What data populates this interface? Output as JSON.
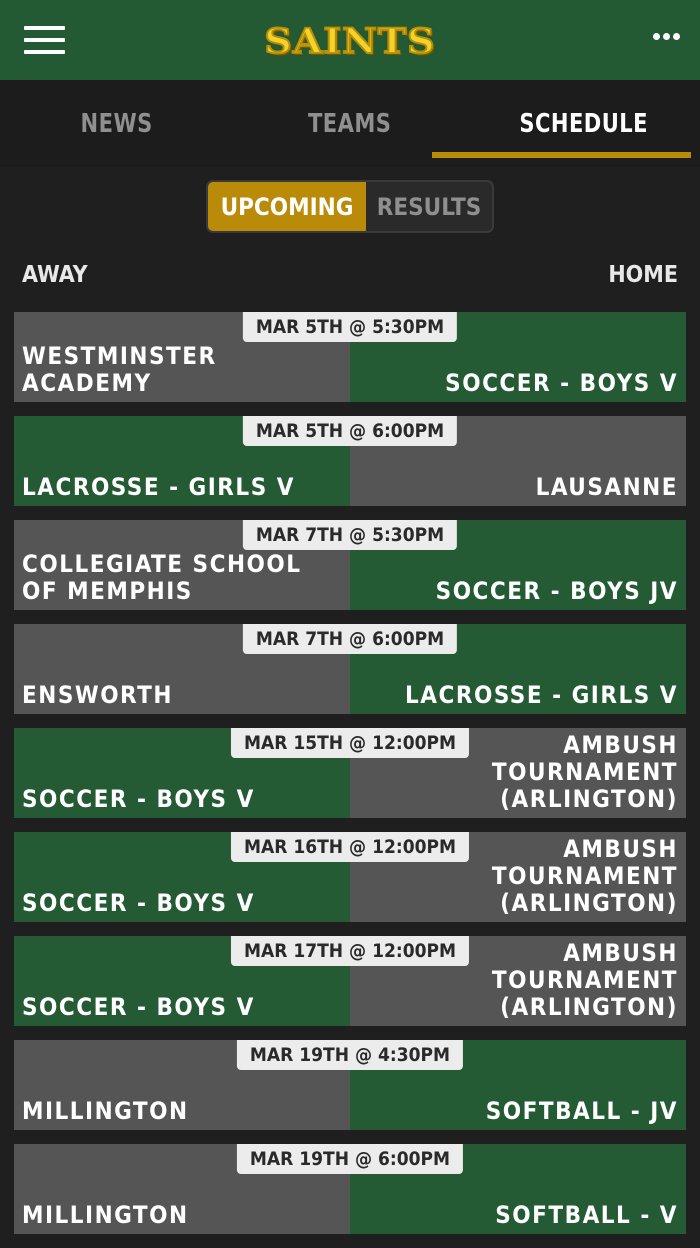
{
  "header": {
    "logo_text": "SAINTS"
  },
  "tabs": [
    {
      "label": "NEWS",
      "active": false
    },
    {
      "label": "TEAMS",
      "active": false
    },
    {
      "label": "SCHEDULE",
      "active": true
    }
  ],
  "segment": {
    "upcoming": "UPCOMING",
    "results": "RESULTS"
  },
  "columns": {
    "away": "AWAY",
    "home": "HOME"
  },
  "colors": {
    "green": "#245a34",
    "gray": "#555555",
    "gold": "#b98b08"
  },
  "games": [
    {
      "date": "MAR 5TH @ 5:30PM",
      "away": "WESTMINSTER\nACADEMY",
      "home": "SOCCER - BOYS V",
      "away_color": "gray",
      "home_color": "green"
    },
    {
      "date": "MAR 5TH @ 6:00PM",
      "away": "LACROSSE - GIRLS V",
      "home": "LAUSANNE",
      "away_color": "green",
      "home_color": "gray"
    },
    {
      "date": "MAR 7TH @ 5:30PM",
      "away": "COLLEGIATE SCHOOL\nOF MEMPHIS",
      "home": "SOCCER - BOYS JV",
      "away_color": "gray",
      "home_color": "green"
    },
    {
      "date": "MAR 7TH @ 6:00PM",
      "away": "ENSWORTH",
      "home": "LACROSSE - GIRLS V",
      "away_color": "gray",
      "home_color": "green"
    },
    {
      "date": "MAR 15TH @ 12:00PM",
      "away": "SOCCER - BOYS V",
      "home": "AMBUSH\nTOURNAMENT\n(ARLINGTON)",
      "away_color": "green",
      "home_color": "gray"
    },
    {
      "date": "MAR 16TH @ 12:00PM",
      "away": "SOCCER - BOYS V",
      "home": "AMBUSH\nTOURNAMENT\n(ARLINGTON)",
      "away_color": "green",
      "home_color": "gray"
    },
    {
      "date": "MAR 17TH @ 12:00PM",
      "away": "SOCCER - BOYS V",
      "home": "AMBUSH\nTOURNAMENT\n(ARLINGTON)",
      "away_color": "green",
      "home_color": "gray"
    },
    {
      "date": "MAR 19TH @ 4:30PM",
      "away": "MILLINGTON",
      "home": "SOFTBALL - JV",
      "away_color": "gray",
      "home_color": "green"
    },
    {
      "date": "MAR 19TH @ 6:00PM",
      "away": "MILLINGTON",
      "home": "SOFTBALL - V",
      "away_color": "gray",
      "home_color": "green"
    }
  ]
}
